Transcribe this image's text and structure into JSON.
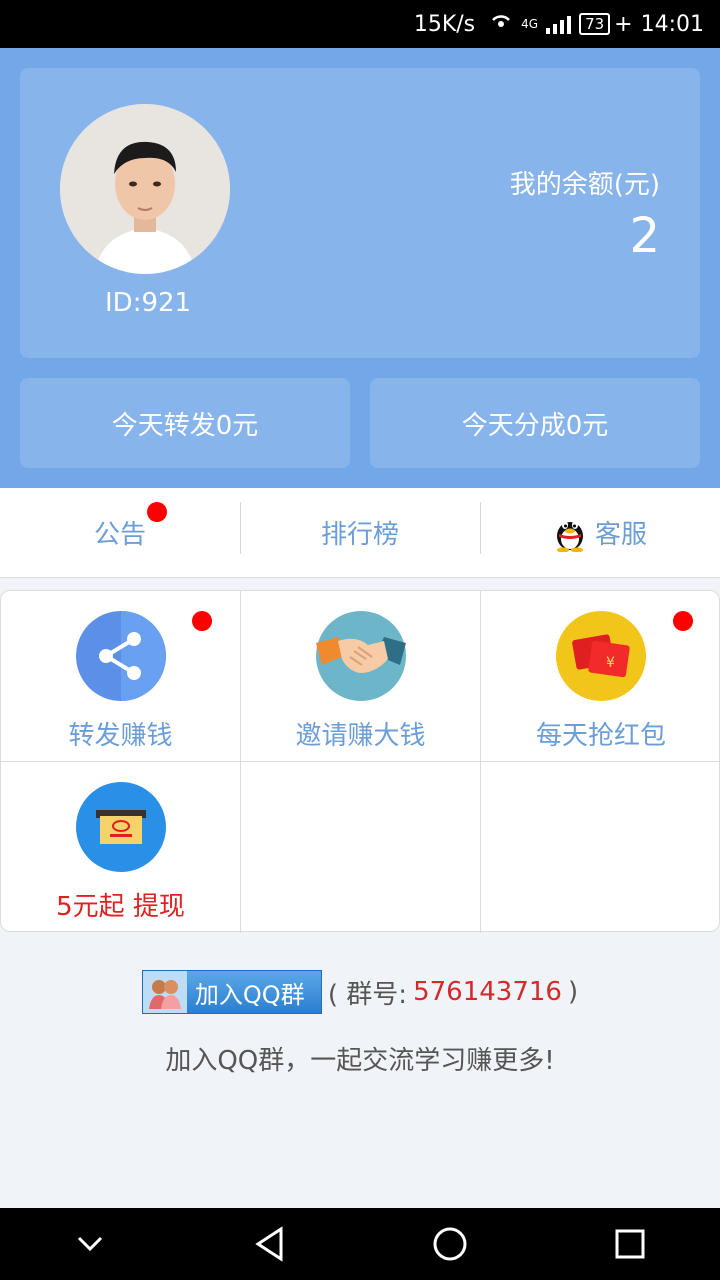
{
  "status_bar": {
    "speed": "15K/s",
    "network": "4G",
    "battery": "73",
    "time": "14:01"
  },
  "profile": {
    "id_label": "ID:921",
    "balance_label": "我的余额(元)",
    "balance_value": "2"
  },
  "stats": {
    "today_forward": "今天转发0元",
    "today_share": "今天分成0元"
  },
  "tabs": [
    {
      "label": "公告",
      "badge": true
    },
    {
      "label": "排行榜",
      "badge": false
    },
    {
      "label": "客服",
      "icon": "qq-penguin-icon"
    }
  ],
  "grid": [
    {
      "label": "转发赚钱",
      "icon": "share-icon",
      "badge": true,
      "color": "#5b8fe8"
    },
    {
      "label": "邀请赚大钱",
      "icon": "handshake-icon",
      "badge": false,
      "color": "#6db5c9"
    },
    {
      "label": "每天抢红包",
      "icon": "red-envelope-icon",
      "badge": true,
      "color": "#f2c51a"
    },
    {
      "label": "5元起 提现",
      "icon": "withdraw-icon",
      "badge": false,
      "color": "#2a8fe6"
    }
  ],
  "footer": {
    "qq_button": "加入QQ群",
    "group_prefix": "( 群号: ",
    "group_number": "576143716",
    "group_suffix": " )",
    "message": "加入QQ群，一起交流学习赚更多!"
  },
  "colors": {
    "header_bg": "#72a8e8",
    "card_bg": "#88b4ec",
    "tab_text": "#6b9ed8",
    "badge": "#ff0000"
  }
}
